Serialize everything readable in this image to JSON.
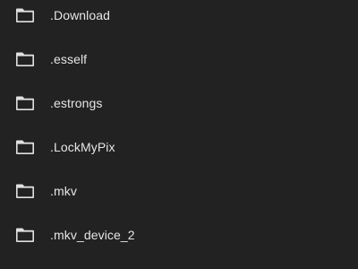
{
  "file_list": {
    "items": [
      {
        "name": ".Download",
        "icon": "folder-icon"
      },
      {
        "name": ".esself",
        "icon": "folder-icon"
      },
      {
        "name": ".estrongs",
        "icon": "folder-icon"
      },
      {
        "name": ".LockMyPix",
        "icon": "folder-icon"
      },
      {
        "name": ".mkv",
        "icon": "folder-icon"
      },
      {
        "name": ".mkv_device_2",
        "icon": "folder-icon"
      }
    ]
  },
  "colors": {
    "background": "#222222",
    "text": "#e6e6e6",
    "icon": "#e0e0e0"
  }
}
